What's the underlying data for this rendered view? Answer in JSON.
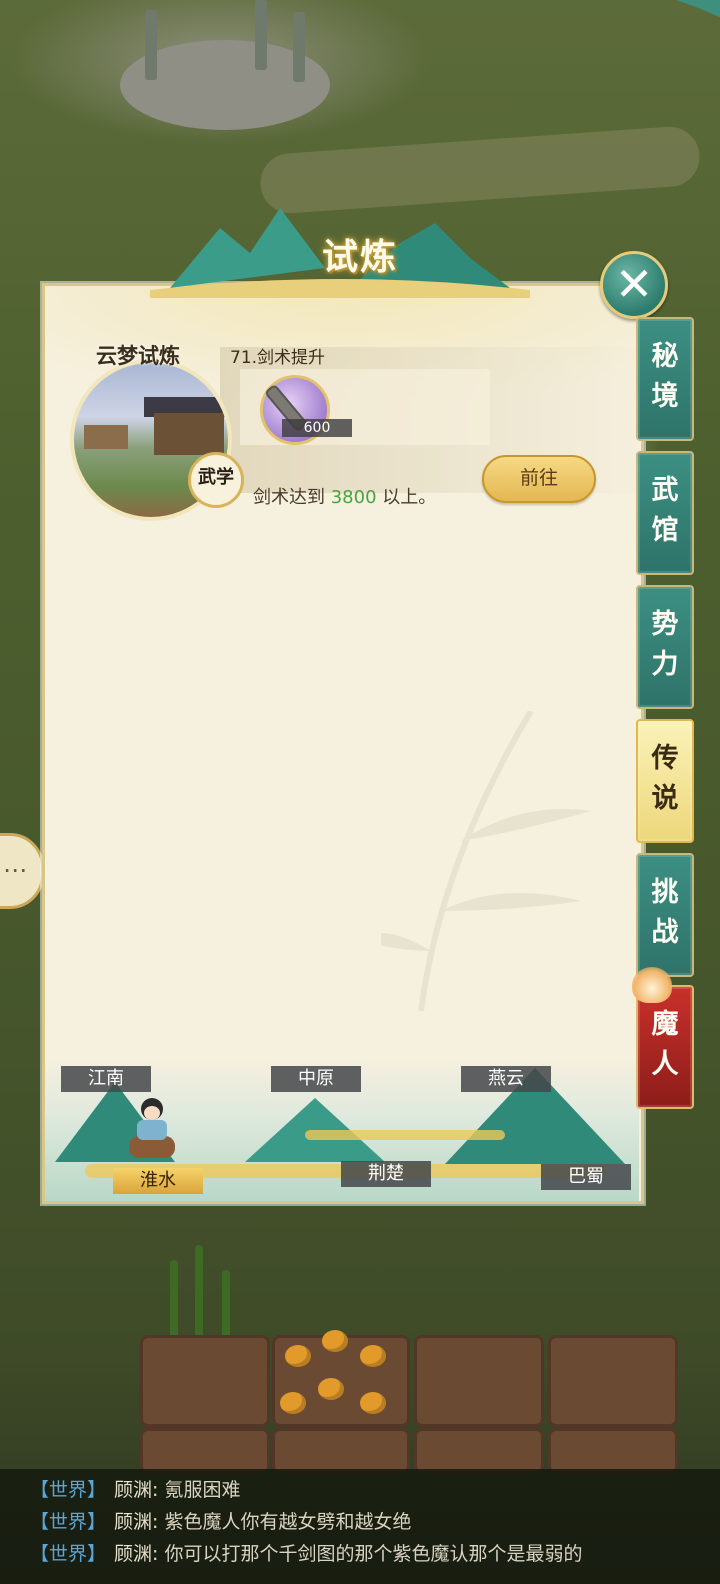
{
  "title": "试炼",
  "close_icon": "close-icon",
  "card": {
    "name": "云梦试炼",
    "subtitle": "71.剑术提升",
    "badge": "武学",
    "reward_icon": "sword-icon",
    "reward_count": "600",
    "requirement_prefix": "剑术达到 ",
    "requirement_value": "3800",
    "requirement_suffix": " 以上。",
    "button_label": "前往"
  },
  "tabs": [
    {
      "label_top": "秘",
      "label_bottom": "境",
      "state": "normal"
    },
    {
      "label_top": "武",
      "label_bottom": "馆",
      "state": "normal"
    },
    {
      "label_top": "势",
      "label_bottom": "力",
      "state": "normal"
    },
    {
      "label_top": "传",
      "label_bottom": "说",
      "state": "active"
    },
    {
      "label_top": "挑",
      "label_bottom": "战",
      "state": "normal"
    },
    {
      "label_top": "魔",
      "label_bottom": "人",
      "state": "red"
    }
  ],
  "regions": {
    "jiangnan": "江南",
    "zhongyuan": "中原",
    "yanyun": "燕云",
    "huaishui": "淮水",
    "jingchu": "荆楚",
    "bashu": "巴蜀"
  },
  "selected_region": "淮水",
  "side_button_icon": "chat-bubble-icon",
  "chat": [
    {
      "channel": "【世界】",
      "user": "顾渊:",
      "text": "氪服困难"
    },
    {
      "channel": "【世界】",
      "user": "顾渊:",
      "text": "紫色魔人你有越女劈和越女绝"
    },
    {
      "channel": "【世界】",
      "user": "顾渊:",
      "text": "你可以打那个千剑图的那个紫色魔认那个是最弱的"
    }
  ],
  "colors": {
    "tab_teal": "#2e7369",
    "tab_active": "#ecd77a",
    "tab_red": "#8c1d1a",
    "accent_gold": "#e4b751",
    "value_green": "#4aa33e",
    "chat_channel": "#5da3d4"
  }
}
